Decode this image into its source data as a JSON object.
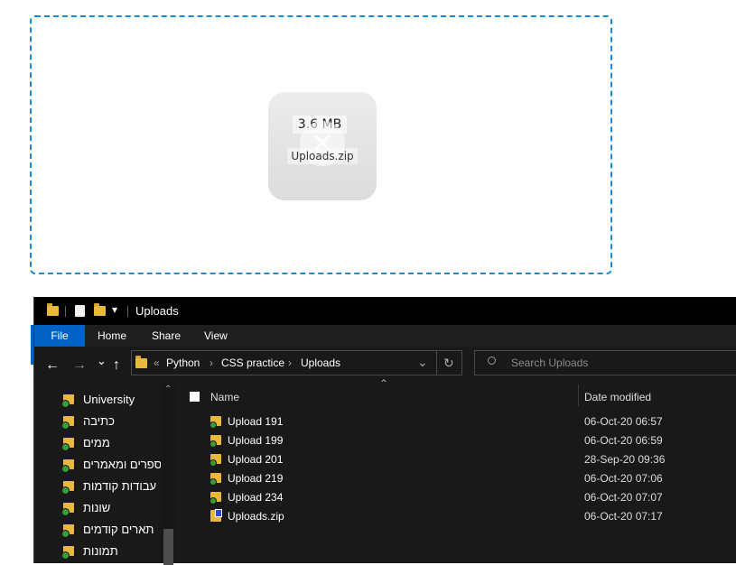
{
  "upload": {
    "file_size": "3.6 MB",
    "file_name": "Uploads.zip",
    "remove_glyph": "✕"
  },
  "titlebar": {
    "title": "Uploads",
    "qa_icons": [
      "folder-icon",
      "properties-icon",
      "new-folder-icon",
      "customize-icon"
    ]
  },
  "ribbon": {
    "tabs": [
      "File",
      "Home",
      "Share",
      "View"
    ]
  },
  "address": {
    "back": "←",
    "forward": "→",
    "recent": "⌄",
    "up": "↑",
    "overflow": "«",
    "crumbs": [
      "Python",
      "CSS practice",
      "Uploads"
    ],
    "dropdown": "⌄",
    "refresh": "↻"
  },
  "search": {
    "placeholder": "Search Uploads"
  },
  "nav_pane": {
    "items": [
      "University",
      "כתיבה",
      "ממים",
      "ספרים ומאמרים",
      "עבודות קודמות",
      "שונות",
      "תארים קודמים",
      "תמונות"
    ]
  },
  "columns": {
    "name": "Name",
    "date": "Date modified"
  },
  "files": [
    {
      "name": "Upload 191",
      "date": "06-Oct-20 06:57"
    },
    {
      "name": "Upload 199",
      "date": "06-Oct-20 06:59"
    },
    {
      "name": "Upload 201",
      "date": "28-Sep-20 09:36"
    },
    {
      "name": "Upload 219",
      "date": "06-Oct-20 07:06"
    },
    {
      "name": "Upload 234",
      "date": "06-Oct-20 07:07"
    },
    {
      "name": "Uploads.zip",
      "date": "06-Oct-20 07:17"
    }
  ],
  "colors": {
    "dropzone_border": "#1a8ad4",
    "file_tab": "#0062c4",
    "explorer_bg": "#191919",
    "folder": "#e8b93c"
  }
}
